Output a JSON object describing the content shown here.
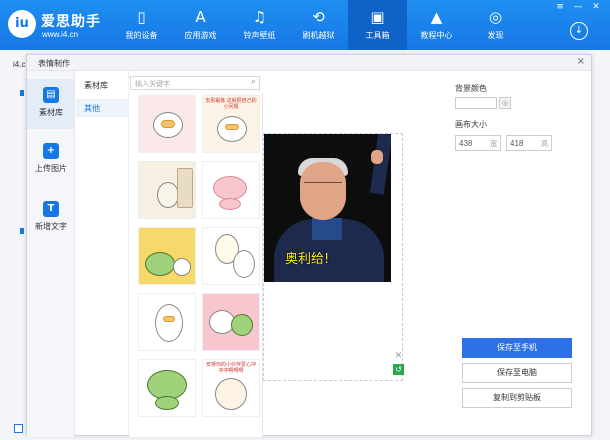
{
  "app": {
    "logo_mark": "iu",
    "name": "爱思助手",
    "url": "www.i4.cn"
  },
  "nav": [
    {
      "label": "我的设备",
      "icon": "phone-icon",
      "glyph": "▯",
      "active": false
    },
    {
      "label": "应用游戏",
      "icon": "app-store-icon",
      "glyph": "A",
      "active": false
    },
    {
      "label": "铃声壁纸",
      "icon": "ringtone-icon",
      "glyph": "♫",
      "active": false
    },
    {
      "label": "刷机越狱",
      "icon": "flash-icon",
      "glyph": "⟲",
      "active": false
    },
    {
      "label": "工具箱",
      "icon": "toolbox-icon",
      "glyph": "▣",
      "active": true
    },
    {
      "label": "教程中心",
      "icon": "graduation-cap-icon",
      "glyph": "▲",
      "active": false
    },
    {
      "label": "发现",
      "icon": "compass-icon",
      "glyph": "◎",
      "active": false
    }
  ],
  "window_controls": {
    "menu": "≡",
    "minimize": "—",
    "close": "✕"
  },
  "download_glyph": "↓",
  "background": {
    "label": "i4.cn"
  },
  "dialog": {
    "title": "表情制作",
    "close_glyph": "×",
    "sidebar": [
      {
        "label": "素材库",
        "glyph": "▤",
        "active": true
      },
      {
        "label": "上传图片",
        "glyph": "+",
        "active": false
      },
      {
        "label": "新增文字",
        "glyph": "T",
        "active": false
      }
    ],
    "categories": {
      "header": "素材库",
      "items": [
        "其他"
      ]
    },
    "search": {
      "placeholder": "输入关键字",
      "icon_glyph": "⌕"
    },
    "sticker_captions": [
      "",
      "去看锻炼 这就把自己的小问题",
      "",
      "",
      "",
      "",
      "",
      "",
      "",
      "安排你的小伙伴爱心冲冲冲啊啊啊"
    ],
    "canvas": {
      "caption": "奥利给!",
      "close_glyph": "✕",
      "undo_glyph": "↺"
    },
    "right": {
      "bg_color_label": "背景颜色",
      "picker_glyph": "◎",
      "canvas_size_label": "画布大小",
      "width_value": "438",
      "width_unit": "宽",
      "height_value": "418",
      "height_unit": "高"
    },
    "buttons": {
      "save_phone": "保存至手机",
      "save_pc": "保存至电脑",
      "copy_clipboard": "复制到剪贴板"
    }
  },
  "colors": {
    "topbar": "#1677e6",
    "nav_active": "#0f62c8",
    "primary_button": "#2e71e6",
    "caption_text": "#f5e32a",
    "undo_button": "#2aa84a"
  }
}
